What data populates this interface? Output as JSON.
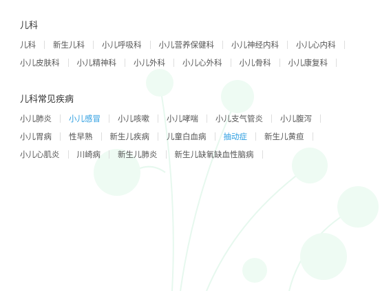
{
  "sections": [
    {
      "title": "儿科",
      "links": [
        {
          "label": "儿科"
        },
        {
          "label": "新生儿科"
        },
        {
          "label": "小儿呼吸科"
        },
        {
          "label": "小儿营养保健科"
        },
        {
          "label": "小儿神经内科"
        },
        {
          "label": "小儿心内科"
        },
        {
          "label": "小儿皮肤科"
        },
        {
          "label": "小儿精神科"
        },
        {
          "label": "小儿外科"
        },
        {
          "label": "小儿心外科"
        },
        {
          "label": "小儿骨科"
        },
        {
          "label": "小儿康复科"
        }
      ]
    },
    {
      "title": "儿科常见疾病",
      "links": [
        {
          "label": "小儿肺炎"
        },
        {
          "label": "小儿感冒",
          "active": true
        },
        {
          "label": "小儿咳嗽"
        },
        {
          "label": "小儿哮喘"
        },
        {
          "label": "小儿支气管炎"
        },
        {
          "label": "小儿腹泻"
        },
        {
          "label": "小儿胃病"
        },
        {
          "label": "性早熟"
        },
        {
          "label": "新生儿疾病"
        },
        {
          "label": "儿童白血病"
        },
        {
          "label": "抽动症",
          "active": true
        },
        {
          "label": "新生儿黄疸"
        },
        {
          "label": "小儿心肌炎"
        },
        {
          "label": "川崎病"
        },
        {
          "label": "新生儿肺炎"
        },
        {
          "label": "新生儿缺氧缺血性脑病"
        }
      ]
    }
  ],
  "colors": {
    "text": "#555555",
    "title": "#333333",
    "active": "#2b9de0",
    "separator": "#dddddd",
    "background_art": "#d8f5e6"
  }
}
